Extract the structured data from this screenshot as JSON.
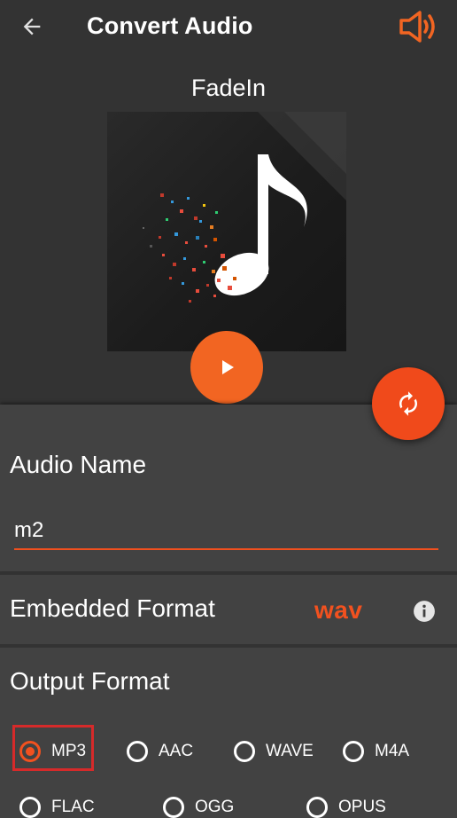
{
  "toolbar": {
    "title": "Convert Audio",
    "back_icon": "arrow-left-icon",
    "speaker_icon": "speaker-icon"
  },
  "header": {
    "track_name": "FadeIn",
    "play_icon": "play-icon",
    "convert_icon": "refresh-icon"
  },
  "audio_name": {
    "label": "Audio Name",
    "value": "m2"
  },
  "embedded_format": {
    "label": "Embedded Format",
    "value": "wav",
    "info_icon": "info-icon"
  },
  "output_format": {
    "label": "Output Format",
    "options": [
      "MP3",
      "AAC",
      "WAVE",
      "M4A",
      "FLAC",
      "OGG",
      "OPUS"
    ],
    "selected": "MP3"
  },
  "colors": {
    "accent": "#f2511f",
    "background": "#333333",
    "panel": "#424242",
    "highlight_box": "#d62a2a"
  }
}
